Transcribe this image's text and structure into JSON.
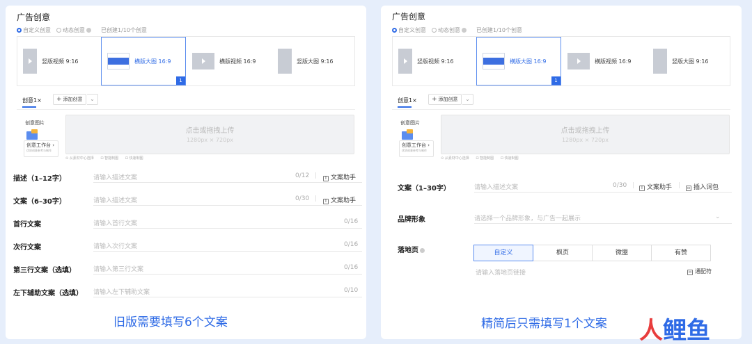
{
  "left": {
    "title": "广告创意",
    "radio_custom": "自定义创意",
    "radio_dynamic": "动态创意",
    "created_count": "已创建1/10个创意",
    "formats": [
      "竖版视频 9:16",
      "横版大图 16:9",
      "横版视频 16:9",
      "竖版大图 9:16"
    ],
    "selected_badge": "1",
    "tab_label": "创意1",
    "tab_close": "×",
    "add_label": "添加创意",
    "image_label": "创意图片",
    "workshop_title": "创意工作台",
    "workshop_sub": "优质创意参考与制作",
    "upload_text": "点击或拖拽上传",
    "upload_size": "1280px × 720px",
    "upload_hints": [
      "从素材中心选择",
      "智能制图",
      "快速制图"
    ],
    "fields": [
      {
        "label": "描述（1–12字）",
        "placeholder": "请输入描述文案",
        "count": "0/12",
        "helper": "文案助手"
      },
      {
        "label": "文案（6–30字）",
        "placeholder": "请输入描述文案",
        "count": "0/30",
        "helper": "文案助手"
      },
      {
        "label": "首行文案",
        "placeholder": "请输入首行文案",
        "count": "0/16"
      },
      {
        "label": "次行文案",
        "placeholder": "请输入次行文案",
        "count": "0/16"
      },
      {
        "label": "第三行文案（选填）",
        "placeholder": "请输入第三行文案",
        "count": "0/16"
      },
      {
        "label": "左下辅助文案（选填）",
        "placeholder": "请输入左下辅助文案",
        "count": "0/10"
      }
    ],
    "caption": "旧版需要填写6个文案"
  },
  "right": {
    "title": "广告创意",
    "radio_custom": "自定义创意",
    "radio_dynamic": "动态创意",
    "created_count": "已创建1/10个创意",
    "formats": [
      "竖版视频 9:16",
      "横版大图 16:9",
      "横版视频 16:9",
      "竖版大图 9:16"
    ],
    "selected_badge": "1",
    "tab_label": "创意1",
    "tab_close": "×",
    "add_label": "添加创意",
    "image_label": "创意图片",
    "workshop_title": "创意工作台",
    "workshop_sub": "优质创意参考与制作",
    "upload_text": "点击或拖拽上传",
    "upload_size": "1280px × 720px",
    "upload_hints": [
      "从素材中心选择",
      "智能制图",
      "快速制图"
    ],
    "copy_label": "文案（1–30字）",
    "copy_placeholder": "请输入描述文案",
    "copy_count": "0/30",
    "copy_helper": "文案助手",
    "copy_insert": "插入词包",
    "brand_label": "品牌形象",
    "brand_placeholder": "请选择一个品牌形象，与广告一起展示",
    "landing_label": "落地页",
    "landing_options": [
      "自定义",
      "枫页",
      "微盟",
      "有赞"
    ],
    "landing_placeholder": "请输入落地页链接",
    "wildcard": "通配符",
    "caption": "精简后只需填写1个文案"
  },
  "watermark": "人鲤鱼",
  "colors": {
    "accent": "#2f6be6",
    "watermark_red": "#e83d3d",
    "watermark_blue": "#2f6be6"
  }
}
